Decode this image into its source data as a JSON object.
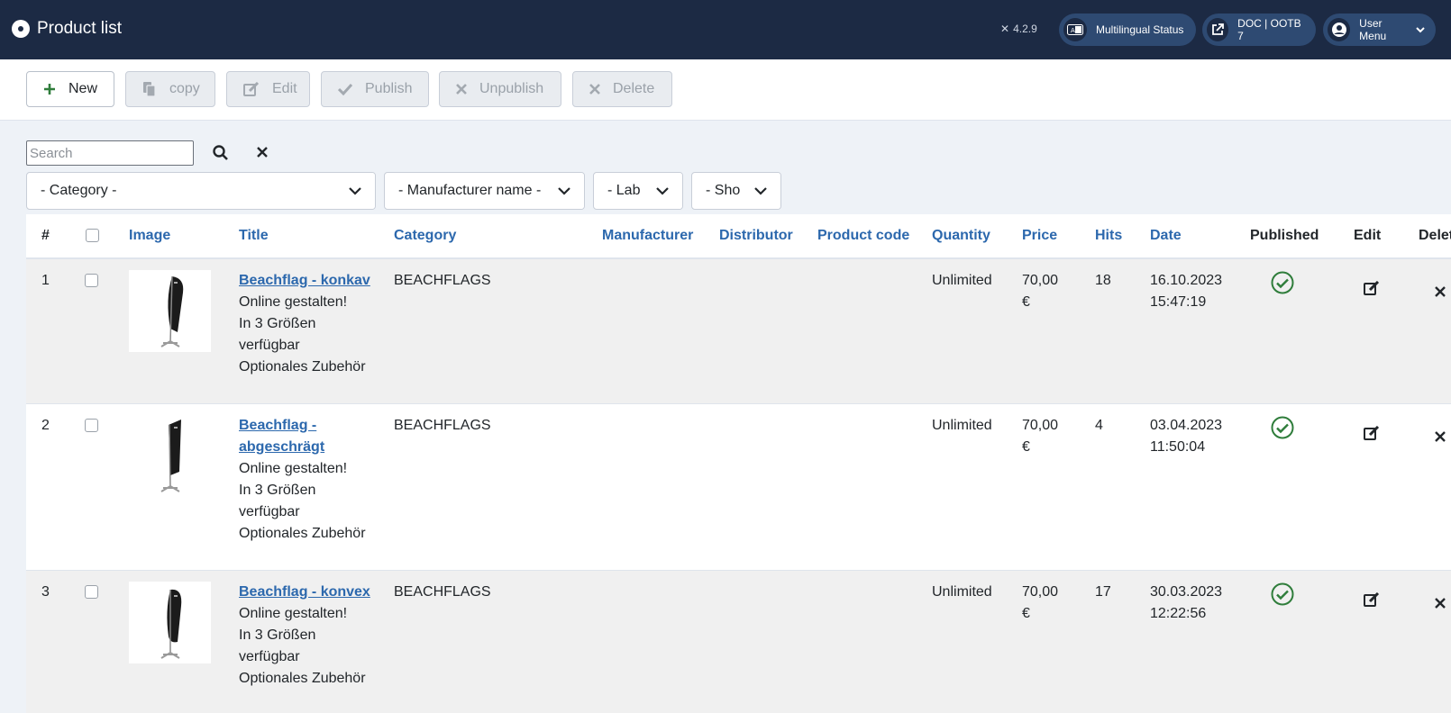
{
  "header": {
    "title": "Product list",
    "version": "4.2.9",
    "multilingual_label": "Multilingual Status",
    "doc_label": "DOC | OOTB 7",
    "user_menu_label": "User Menu"
  },
  "toolbar": {
    "new_label": "New",
    "copy_label": "copy",
    "edit_label": "Edit",
    "publish_label": "Publish",
    "unpublish_label": "Unpublish",
    "delete_label": "Delete"
  },
  "filters": {
    "search_placeholder": "Search",
    "category": "- Category -",
    "manufacturer": "- Manufacturer name -",
    "label": "- Lab",
    "show": "- Sho"
  },
  "table": {
    "headers": {
      "num": "#",
      "image": "Image",
      "title": "Title",
      "category": "Category",
      "manufacturer": "Manufacturer",
      "distributor": "Distributor",
      "product_code": "Product code",
      "quantity": "Quantity",
      "price": "Price",
      "hits": "Hits",
      "date": "Date",
      "published": "Published",
      "edit": "Edit",
      "delete": "Delet"
    },
    "rows": [
      {
        "num": "1",
        "title": "Beachflag - konkav",
        "desc1": "Online gestalten!",
        "desc2": "In 3 Größen verfügbar",
        "desc3": "Optionales Zubehör",
        "category": "BEACHFLAGS",
        "quantity": "Unlimited",
        "price": "70,00 €",
        "hits": "18",
        "date": "16.10.2023 15:47:19"
      },
      {
        "num": "2",
        "title": "Beachflag - abgeschrägt",
        "desc1": "Online gestalten!",
        "desc2": "In 3 Größen verfügbar",
        "desc3": "Optionales Zubehör",
        "category": "BEACHFLAGS",
        "quantity": "Unlimited",
        "price": "70,00 €",
        "hits": "4",
        "date": "03.04.2023 11:50:04"
      },
      {
        "num": "3",
        "title": "Beachflag - konvex",
        "desc1": "Online gestalten!",
        "desc2": "In 3 Größen verfügbar",
        "desc3": "Optionales Zubehör",
        "category": "BEACHFLAGS",
        "quantity": "Unlimited",
        "price": "70,00 €",
        "hits": "17",
        "date": "30.03.2023 12:22:56"
      }
    ]
  },
  "colors": {
    "header_bg": "#1c2a44",
    "link": "#2c68ad",
    "published_green": "#2f7d3b"
  }
}
